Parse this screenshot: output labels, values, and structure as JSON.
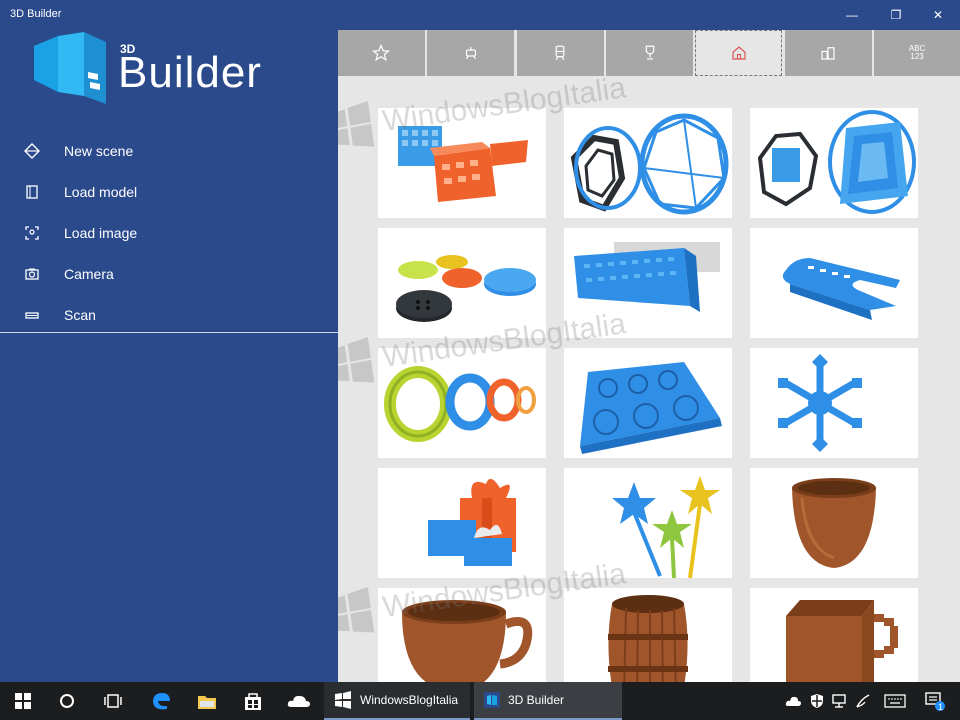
{
  "window": {
    "title": "3D Builder",
    "minimize_glyph": "—",
    "maximize_glyph": "❐",
    "close_glyph": "✕"
  },
  "logo": {
    "small": "3D",
    "word": "Builder"
  },
  "menu": [
    {
      "label": "New scene",
      "icon": "new-scene-icon"
    },
    {
      "label": "Load model",
      "icon": "load-model-icon"
    },
    {
      "label": "Load image",
      "icon": "load-image-icon"
    },
    {
      "label": "Camera",
      "icon": "camera-icon"
    },
    {
      "label": "Scan",
      "icon": "scan-icon"
    }
  ],
  "tabs": [
    {
      "icon": "star-icon"
    },
    {
      "icon": "robot-icon"
    },
    {
      "icon": "train-icon"
    },
    {
      "icon": "trophy-icon"
    },
    {
      "icon": "home-icon",
      "active": true
    },
    {
      "icon": "buildings-icon"
    },
    {
      "icon": "text-icon",
      "line1": "ABC",
      "line2": "123"
    }
  ],
  "tiles": [
    {
      "name": "baskets"
    },
    {
      "name": "wire-ring-dark"
    },
    {
      "name": "wire-ring-blue"
    },
    {
      "name": "buttons"
    },
    {
      "name": "phone-stand"
    },
    {
      "name": "money-clip"
    },
    {
      "name": "bangles"
    },
    {
      "name": "emoji-mold"
    },
    {
      "name": "snowflake"
    },
    {
      "name": "gift-boxes"
    },
    {
      "name": "star-wands"
    },
    {
      "name": "wooden-cup"
    },
    {
      "name": "mug"
    },
    {
      "name": "barrel-mug"
    },
    {
      "name": "pixel-mug"
    }
  ],
  "watermark": "WindowsBlogItalia",
  "taskbar": {
    "app1": "WindowsBlogItalia",
    "app2": "3D Builder",
    "notification_count": "1"
  },
  "colors": {
    "sidebar": "#2b4a8c",
    "tab": "#a7a7a7",
    "content_bg": "#e6e6e6",
    "accent_active": "#d9534f",
    "model_blue": "#2f8fe6",
    "model_orange": "#f0622c",
    "model_wood": "#a0562a"
  }
}
